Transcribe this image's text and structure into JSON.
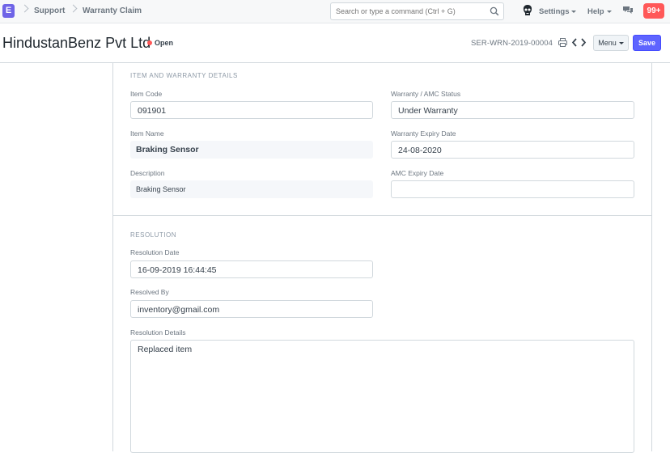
{
  "navbar": {
    "logo_letter": "E",
    "breadcrumbs": [
      "Support",
      "Warranty Claim"
    ],
    "search_placeholder": "Search or type a command (Ctrl + G)",
    "settings_label": "Settings",
    "help_label": "Help",
    "notification_count": "99+"
  },
  "page": {
    "title": "HindustanBenz Pvt Ltd",
    "status": "Open",
    "doc_name": "SER-WRN-2019-00004",
    "menu_label": "Menu",
    "save_label": "Save"
  },
  "sections": {
    "item_warranty": {
      "heading": "ITEM AND WARRANTY DETAILS",
      "item_code_label": "Item Code",
      "item_code_value": "091901",
      "item_name_label": "Item Name",
      "item_name_value": "Braking Sensor",
      "description_label": "Description",
      "description_value": "Braking Sensor",
      "warranty_status_label": "Warranty / AMC Status",
      "warranty_status_value": "Under Warranty",
      "warranty_expiry_label": "Warranty Expiry Date",
      "warranty_expiry_value": "24-08-2020",
      "amc_expiry_label": "AMC Expiry Date",
      "amc_expiry_value": ""
    },
    "resolution": {
      "heading": "RESOLUTION",
      "resolution_date_label": "Resolution Date",
      "resolution_date_value": "16-09-2019 16:44:45",
      "resolved_by_label": "Resolved By",
      "resolved_by_value": "inventory@gmail.com",
      "resolution_details_label": "Resolution Details",
      "resolution_details_value": "Replaced item"
    }
  },
  "colors": {
    "brand": "#6f64e7",
    "primary": "#5e64ff",
    "status_red": "#ff5858"
  }
}
